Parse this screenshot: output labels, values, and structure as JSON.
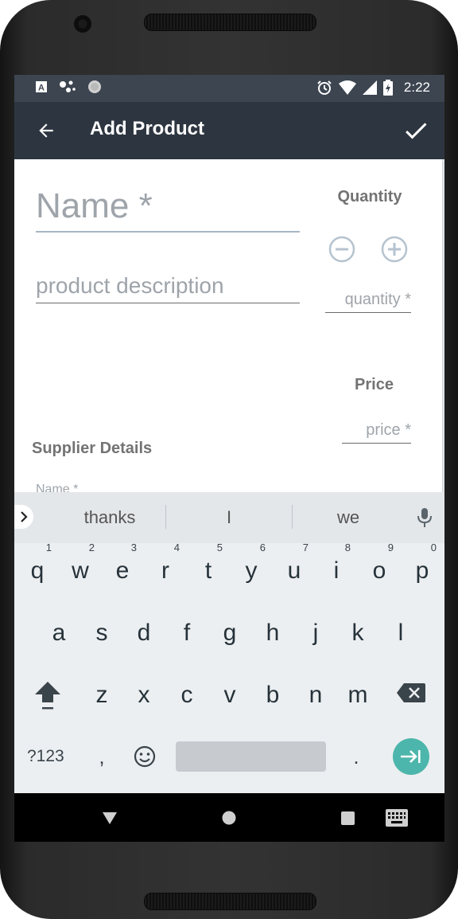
{
  "status_bar": {
    "time": "2:22",
    "left_icons": [
      "a-notification-icon",
      "assistant-dots-icon",
      "circle-notification-icon"
    ],
    "right_icons": [
      "alarm-icon",
      "wifi-icon",
      "signal-icon",
      "battery-charging-icon"
    ]
  },
  "toolbar": {
    "title": "Add Product",
    "back_icon": "arrow-back-icon",
    "save_icon": "check-icon"
  },
  "form": {
    "name_placeholder": "Name *",
    "description_placeholder": "product description",
    "quantity_label": "Quantity",
    "quantity_placeholder": "quantity *",
    "price_label": "Price",
    "price_placeholder": "price *",
    "supplier_title": "Supplier Details",
    "supplier_name_label": "Name *"
  },
  "keyboard": {
    "suggestions": [
      "thanks",
      "I",
      "we"
    ],
    "row1": [
      {
        "k": "q",
        "h": "1"
      },
      {
        "k": "w",
        "h": "2"
      },
      {
        "k": "e",
        "h": "3"
      },
      {
        "k": "r",
        "h": "4"
      },
      {
        "k": "t",
        "h": "5"
      },
      {
        "k": "y",
        "h": "6"
      },
      {
        "k": "u",
        "h": "7"
      },
      {
        "k": "i",
        "h": "8"
      },
      {
        "k": "o",
        "h": "9"
      },
      {
        "k": "p",
        "h": "0"
      }
    ],
    "row2": [
      "a",
      "s",
      "d",
      "f",
      "g",
      "h",
      "j",
      "k",
      "l"
    ],
    "row3": [
      "z",
      "x",
      "c",
      "v",
      "b",
      "n",
      "m"
    ],
    "symbols_label": "?123",
    "comma": ",",
    "period": ".",
    "accent_color": "#4db6ac"
  },
  "colors": {
    "toolbar": "#2d3640",
    "status_bar": "#3c4550"
  }
}
